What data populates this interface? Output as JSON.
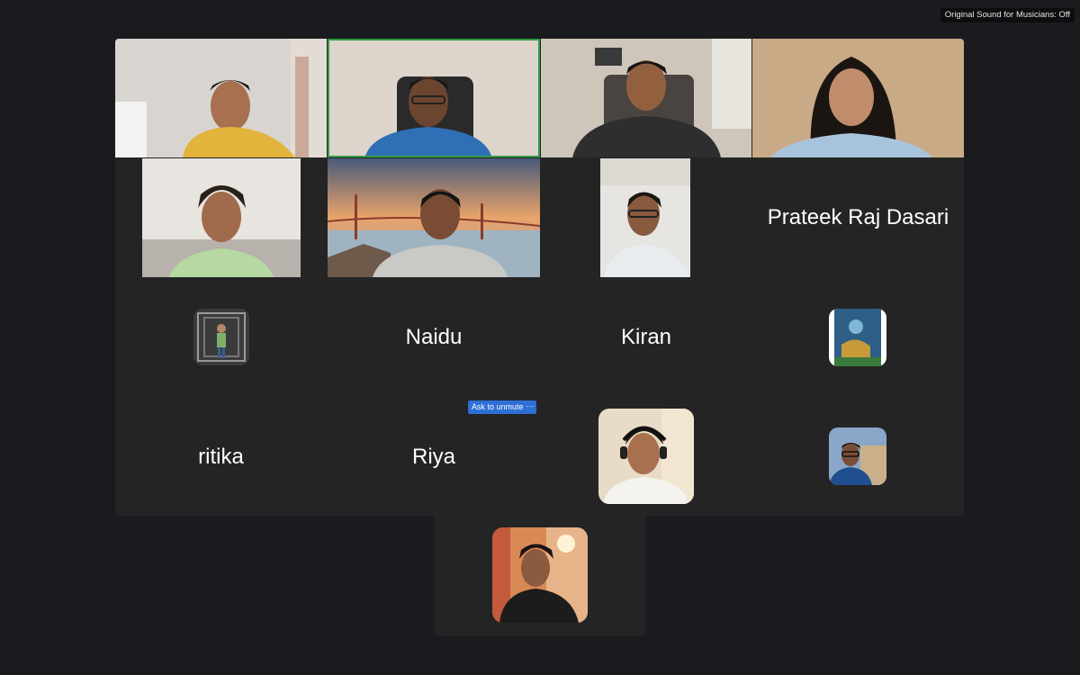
{
  "meeting": {
    "original_sound_status": "Original Sound for Musicians: Off"
  },
  "participants": {
    "prateek": {
      "name": "Prateek Raj Dasari"
    },
    "naidu": {
      "name": "Naidu"
    },
    "kiran": {
      "name": "Kiran"
    },
    "ritika": {
      "name": "ritika"
    },
    "riya": {
      "name": "Riya",
      "ask_to_unmute_label": "Ask to unmute",
      "more_label": "···"
    }
  },
  "colors": {
    "background": "#1a1b1f",
    "tile": "#242424",
    "active_speaker_border": "#2f9e44",
    "button_blue": "#2d6fd6"
  },
  "icons": {
    "more": "more-options-icon"
  }
}
